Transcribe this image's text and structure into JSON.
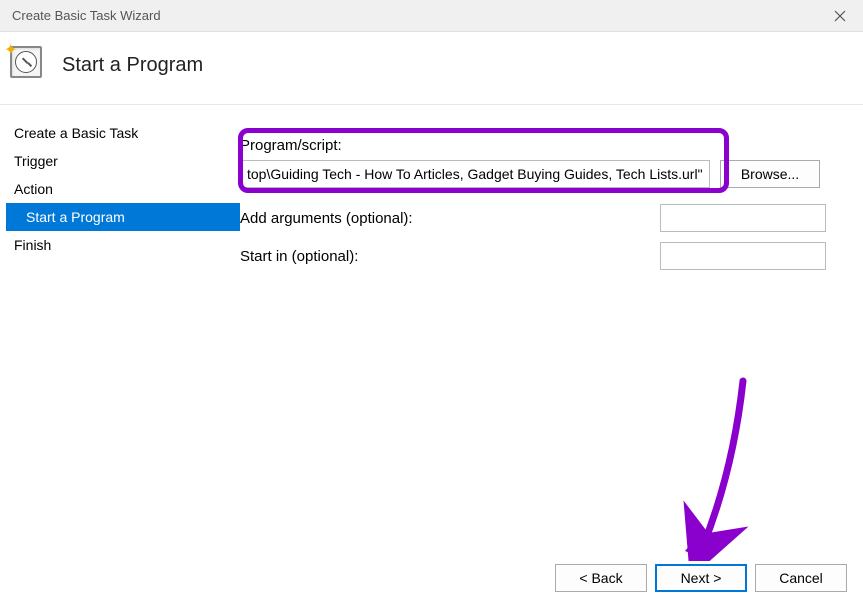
{
  "window": {
    "title": "Create Basic Task Wizard"
  },
  "header": {
    "title": "Start a Program"
  },
  "sidebar": {
    "items": [
      {
        "label": "Create a Basic Task",
        "selected": false,
        "sub": false
      },
      {
        "label": "Trigger",
        "selected": false,
        "sub": false
      },
      {
        "label": "Action",
        "selected": false,
        "sub": false
      },
      {
        "label": "Start a Program",
        "selected": true,
        "sub": true
      },
      {
        "label": "Finish",
        "selected": false,
        "sub": false
      }
    ]
  },
  "form": {
    "program_label": "Program/script:",
    "program_value": "top\\Guiding Tech - How To Articles, Gadget Buying Guides, Tech Lists.url\"",
    "browse_label": "Browse...",
    "args_label": "Add arguments (optional):",
    "args_value": "",
    "startin_label": "Start in (optional):",
    "startin_value": ""
  },
  "footer": {
    "back_label": "< Back",
    "next_label": "Next >",
    "cancel_label": "Cancel"
  },
  "annotations": {
    "highlight_color": "#8a00cc",
    "arrow_color": "#8a00cc"
  }
}
